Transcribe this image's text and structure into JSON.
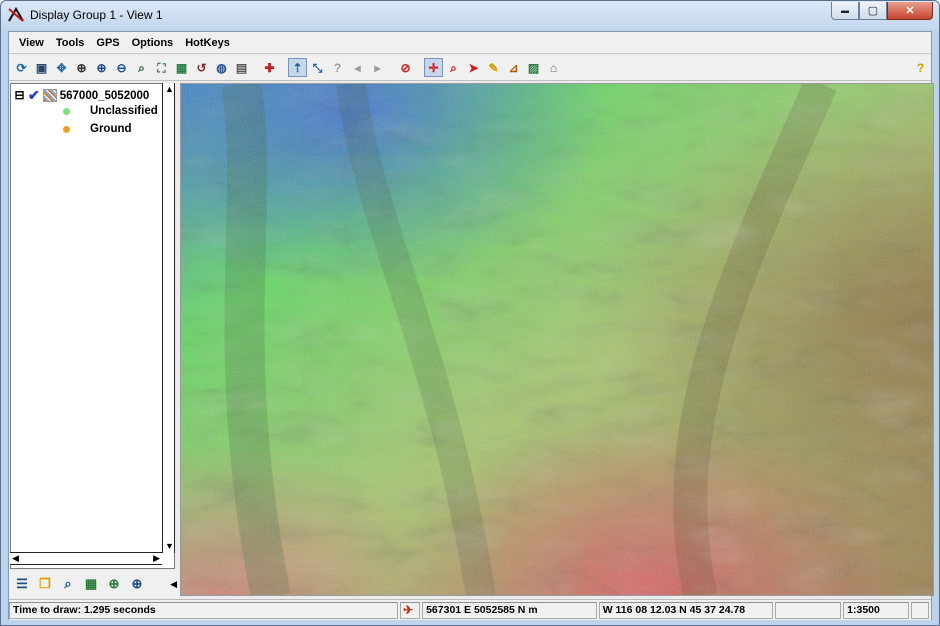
{
  "window": {
    "title": "Display Group 1 - View 1",
    "minimize_glyph": "▬",
    "maximize_glyph": "▢",
    "close_glyph": "✕"
  },
  "menu": [
    "View",
    "Tools",
    "GPS",
    "Options",
    "HotKeys"
  ],
  "toolbar": [
    {
      "icon": "redraw-icon",
      "glyph": "⟳",
      "color": "#1c6aa8"
    },
    {
      "icon": "full-extent-icon",
      "glyph": "▣",
      "color": "#26466e"
    },
    {
      "icon": "pan-icon",
      "glyph": "✥",
      "color": "#2f6fa3"
    },
    {
      "icon": "binoculars-icon",
      "glyph": "⊕",
      "color": "#333333"
    },
    {
      "icon": "zoom-in-icon",
      "glyph": "⊕",
      "color": "#1d4f8a"
    },
    {
      "icon": "zoom-out-icon",
      "glyph": "⊖",
      "color": "#1d4f8a"
    },
    {
      "icon": "zoom-box-icon",
      "glyph": "⌕",
      "color": "#2a6a3a"
    },
    {
      "icon": "zoom-extent-icon",
      "glyph": "⛶",
      "color": "#2a7d45"
    },
    {
      "icon": "zoom-layer-icon",
      "glyph": "▦",
      "color": "#2a7d45"
    },
    {
      "icon": "zoom-previous-icon",
      "glyph": "↺",
      "color": "#8a2a2a"
    },
    {
      "icon": "globe-icon",
      "glyph": "◍",
      "color": "#2a4f8a"
    },
    {
      "icon": "snapshot-camera-icon",
      "glyph": "▤",
      "color": "#555555"
    },
    {
      "icon": "add-layer-icon",
      "glyph": "✚",
      "color": "#c02020"
    },
    {
      "icon": "select-mode-icon",
      "glyph": "⇡",
      "color": "#1d5ea8"
    },
    {
      "icon": "multi-select-icon",
      "glyph": "⤡",
      "color": "#1d5ea8"
    },
    {
      "icon": "query-icon",
      "glyph": "?",
      "color": "#9a9a9a"
    },
    {
      "icon": "back-icon",
      "glyph": "◂",
      "color": "#9a9a9a"
    },
    {
      "icon": "forward-icon",
      "glyph": "▸",
      "color": "#9a9a9a"
    },
    {
      "icon": "cancel-draw-icon",
      "glyph": "⊘",
      "color": "#d11a1a"
    },
    {
      "icon": "move-icon",
      "glyph": "✛",
      "color": "#d11a1a"
    },
    {
      "icon": "zoom-red-icon",
      "glyph": "⌕",
      "color": "#d11a1a"
    },
    {
      "icon": "arrow-pointer-icon",
      "glyph": "➤",
      "color": "#d11a1a"
    },
    {
      "icon": "pencil-icon",
      "glyph": "✎",
      "color": "#d49a00"
    },
    {
      "icon": "measure-icon",
      "glyph": "⊿",
      "color": "#b05a00"
    },
    {
      "icon": "chart-icon",
      "glyph": "▨",
      "color": "#2a7a3a"
    },
    {
      "icon": "gps-icon",
      "glyph": "⌂",
      "color": "#666666"
    },
    {
      "icon": "help-icon",
      "glyph": "?",
      "color": "#c9a000"
    }
  ],
  "layers": {
    "group_label": "567000_5052000",
    "expander_glyph": "⊟",
    "check_glyph": "✔",
    "items": [
      {
        "label": "Unclassified",
        "color": "#7fe07f"
      },
      {
        "label": "Ground",
        "color": "#f0a020"
      }
    ]
  },
  "lower_tools": [
    {
      "icon": "legend-icon",
      "glyph": "☰",
      "color": "#1d4f8a"
    },
    {
      "icon": "layer-controls-icon",
      "glyph": "❐",
      "color": "#d9a000"
    },
    {
      "icon": "find-icon",
      "glyph": "⌕",
      "color": "#1d4f8a"
    },
    {
      "icon": "zoom-to-layer-icon",
      "glyph": "▦",
      "color": "#2a7a3a"
    },
    {
      "icon": "zoom-layer-fit-icon",
      "glyph": "⊕",
      "color": "#2a7a3a"
    },
    {
      "icon": "zoom-in-small-icon",
      "glyph": "⊕",
      "color": "#1d4f8a"
    }
  ],
  "status": {
    "draw_time": "Time to draw: 1.295 seconds",
    "coords_projected": "567301 E  5052585 N m",
    "coords_geographic": "W 116 08 12.03  N 45 37 24.78",
    "scale": "1:3500"
  },
  "colors": {
    "map_low": "#3a6fd4",
    "map_mid": "#5fdc5c",
    "map_high": "#b49a44",
    "map_red": "#e05a62"
  }
}
